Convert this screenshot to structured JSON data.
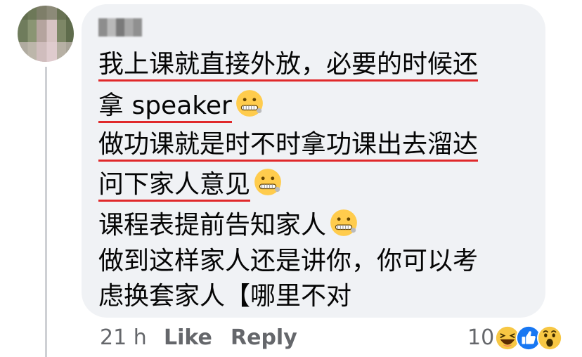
{
  "comment": {
    "lines": [
      "我上课就直接外放，必要的时候还",
      "拿 speaker",
      "做功课就是时不时拿功课出去溜达",
      "问下家人意见",
      "课程表提前告知家人",
      "做到这样家人还是讲你，你可以考",
      "虑换套家人【哪里不对"
    ],
    "emoji": "zipper-mouth-face"
  },
  "footer": {
    "time": "21 h",
    "like_label": "Like",
    "reply_label": "Reply",
    "reaction_count": "10",
    "reactions": [
      "haha",
      "like",
      "wow"
    ]
  },
  "colors": {
    "bubble": "#f0f2f5",
    "underline": "#e0292b",
    "meta_text": "#65676b",
    "like_blue": "#1877f2"
  }
}
